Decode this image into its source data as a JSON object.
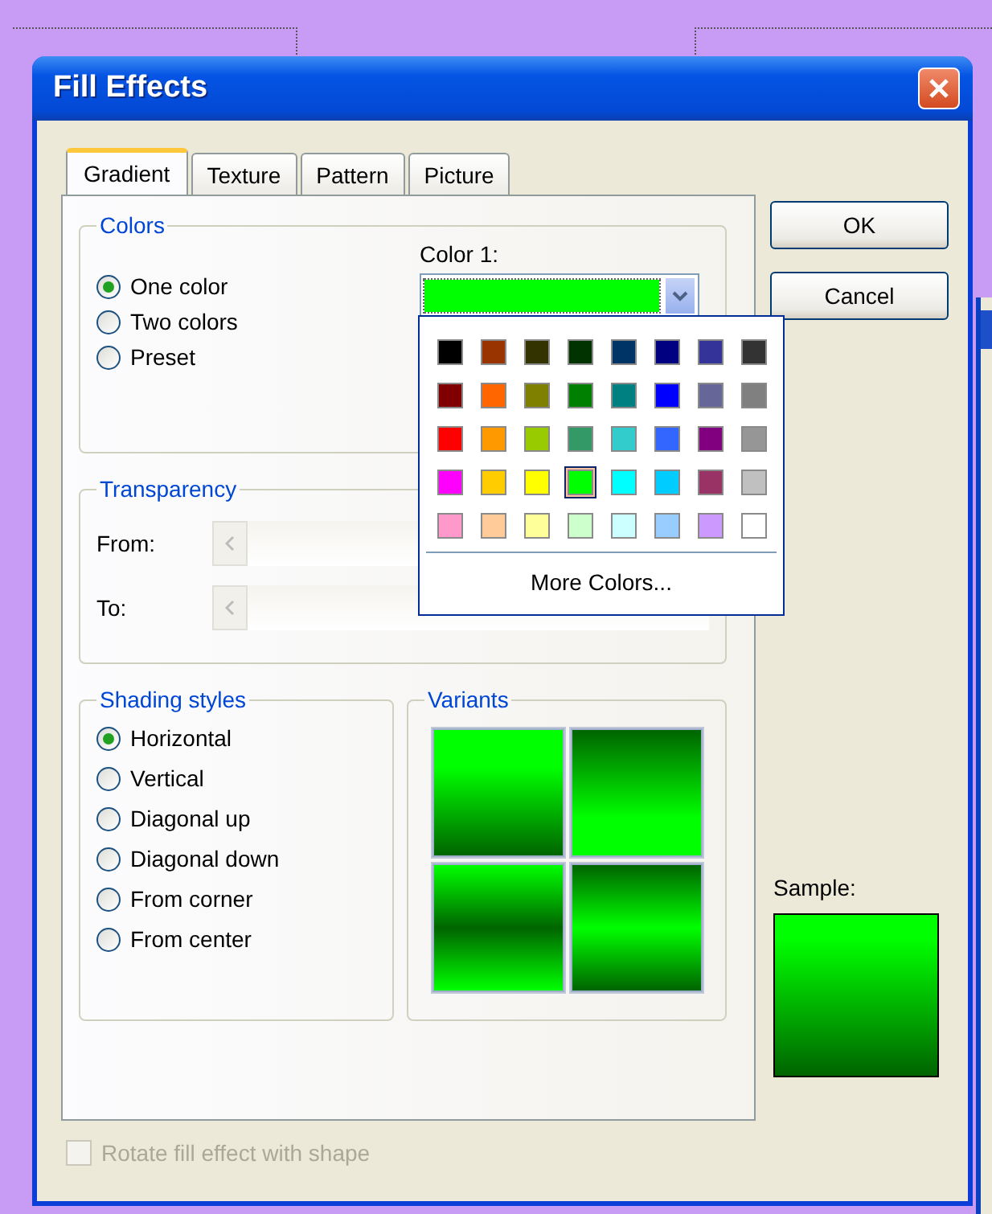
{
  "window": {
    "title": "Fill Effects"
  },
  "tabs": [
    {
      "label": "Gradient",
      "selected": true
    },
    {
      "label": "Texture",
      "selected": false
    },
    {
      "label": "Pattern",
      "selected": false
    },
    {
      "label": "Picture",
      "selected": false
    }
  ],
  "colors": {
    "legend": "Colors",
    "options": [
      {
        "label": "One color",
        "selected": true
      },
      {
        "label": "Two colors",
        "selected": false
      },
      {
        "label": "Preset",
        "selected": false
      }
    ],
    "color1_label": "Color 1:"
  },
  "palette": {
    "swatches": [
      {
        "color": "#000000",
        "selected": false
      },
      {
        "color": "#993300",
        "selected": false
      },
      {
        "color": "#333300",
        "selected": false
      },
      {
        "color": "#003300",
        "selected": false
      },
      {
        "color": "#003366",
        "selected": false
      },
      {
        "color": "#000080",
        "selected": false
      },
      {
        "color": "#333399",
        "selected": false
      },
      {
        "color": "#333333",
        "selected": false
      },
      {
        "color": "#800000",
        "selected": false
      },
      {
        "color": "#ff6600",
        "selected": false
      },
      {
        "color": "#808000",
        "selected": false
      },
      {
        "color": "#008000",
        "selected": false
      },
      {
        "color": "#008080",
        "selected": false
      },
      {
        "color": "#0000ff",
        "selected": false
      },
      {
        "color": "#666699",
        "selected": false
      },
      {
        "color": "#808080",
        "selected": false
      },
      {
        "color": "#ff0000",
        "selected": false
      },
      {
        "color": "#ff9900",
        "selected": false
      },
      {
        "color": "#99cc00",
        "selected": false
      },
      {
        "color": "#339966",
        "selected": false
      },
      {
        "color": "#33cccc",
        "selected": false
      },
      {
        "color": "#3366ff",
        "selected": false
      },
      {
        "color": "#800080",
        "selected": false
      },
      {
        "color": "#969696",
        "selected": false
      },
      {
        "color": "#ff00ff",
        "selected": false
      },
      {
        "color": "#ffcc00",
        "selected": false
      },
      {
        "color": "#ffff00",
        "selected": false
      },
      {
        "color": "#00ff00",
        "selected": true
      },
      {
        "color": "#00ffff",
        "selected": false
      },
      {
        "color": "#00ccff",
        "selected": false
      },
      {
        "color": "#993366",
        "selected": false
      },
      {
        "color": "#c0c0c0",
        "selected": false
      },
      {
        "color": "#ff99cc",
        "selected": false
      },
      {
        "color": "#ffcc99",
        "selected": false
      },
      {
        "color": "#ffff99",
        "selected": false
      },
      {
        "color": "#ccffcc",
        "selected": false
      },
      {
        "color": "#ccffff",
        "selected": false
      },
      {
        "color": "#99ccff",
        "selected": false
      },
      {
        "color": "#cc99ff",
        "selected": false
      },
      {
        "color": "#ffffff",
        "selected": false
      }
    ],
    "more": "More Colors..."
  },
  "transparency": {
    "legend": "Transparency",
    "rows": [
      {
        "label": "From:"
      },
      {
        "label": "To:"
      }
    ]
  },
  "shading": {
    "legend": "Shading styles",
    "options": [
      {
        "label": "Horizontal",
        "selected": true
      },
      {
        "label": "Vertical",
        "selected": false
      },
      {
        "label": "Diagonal up",
        "selected": false
      },
      {
        "label": "Diagonal down",
        "selected": false
      },
      {
        "label": "From corner",
        "selected": false
      },
      {
        "label": "From center",
        "selected": false
      }
    ]
  },
  "variants": {
    "legend": "Variants"
  },
  "buttons": [
    "OK",
    "Cancel"
  ],
  "sample_label": "Sample:",
  "rotate": {
    "label": "Rotate fill effect with shape",
    "checked": false,
    "disabled": true
  }
}
